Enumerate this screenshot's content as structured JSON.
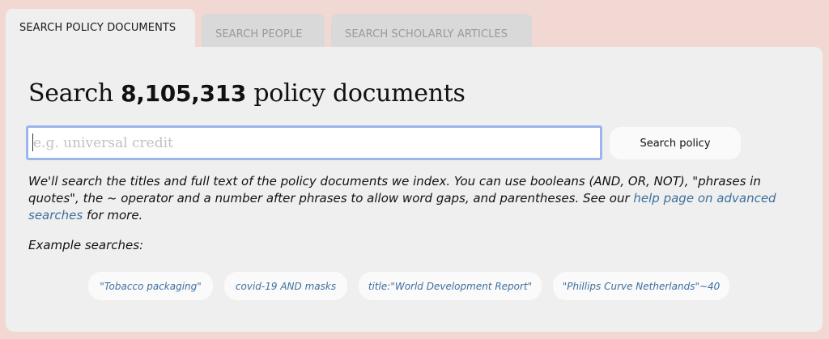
{
  "tabs": [
    {
      "label": "SEARCH POLICY DOCUMENTS",
      "active": true
    },
    {
      "label": "SEARCH PEOPLE",
      "active": false
    },
    {
      "label": "SEARCH SCHOLARLY ARTICLES",
      "active": false
    }
  ],
  "heading": {
    "prefix": "Search",
    "count": "8,105,313",
    "suffix": "policy documents"
  },
  "search": {
    "placeholder": "e.g. universal credit",
    "value": "",
    "button_label": "Search policy"
  },
  "help": {
    "text": "We'll search the titles and full text of the policy documents we index. You can use booleans (AND, OR, NOT), \"phrases in quotes\", the ~ operator and a number after phrases to allow word gaps, and parentheses. See our",
    "link_text": "help page on advanced searches",
    "after_link": "for more."
  },
  "examples": {
    "label": "Example searches:",
    "items": [
      "\"Tobacco packaging\"",
      "covid-19 AND masks",
      "title:\"World Development Report\"",
      "\"Phillips Curve Netherlands\"~40"
    ]
  },
  "colors": {
    "page_background": "#f2d8d2",
    "panel_background": "#efefef",
    "link": "#3d6f9e",
    "input_focus_border": "#9bb6ea"
  }
}
